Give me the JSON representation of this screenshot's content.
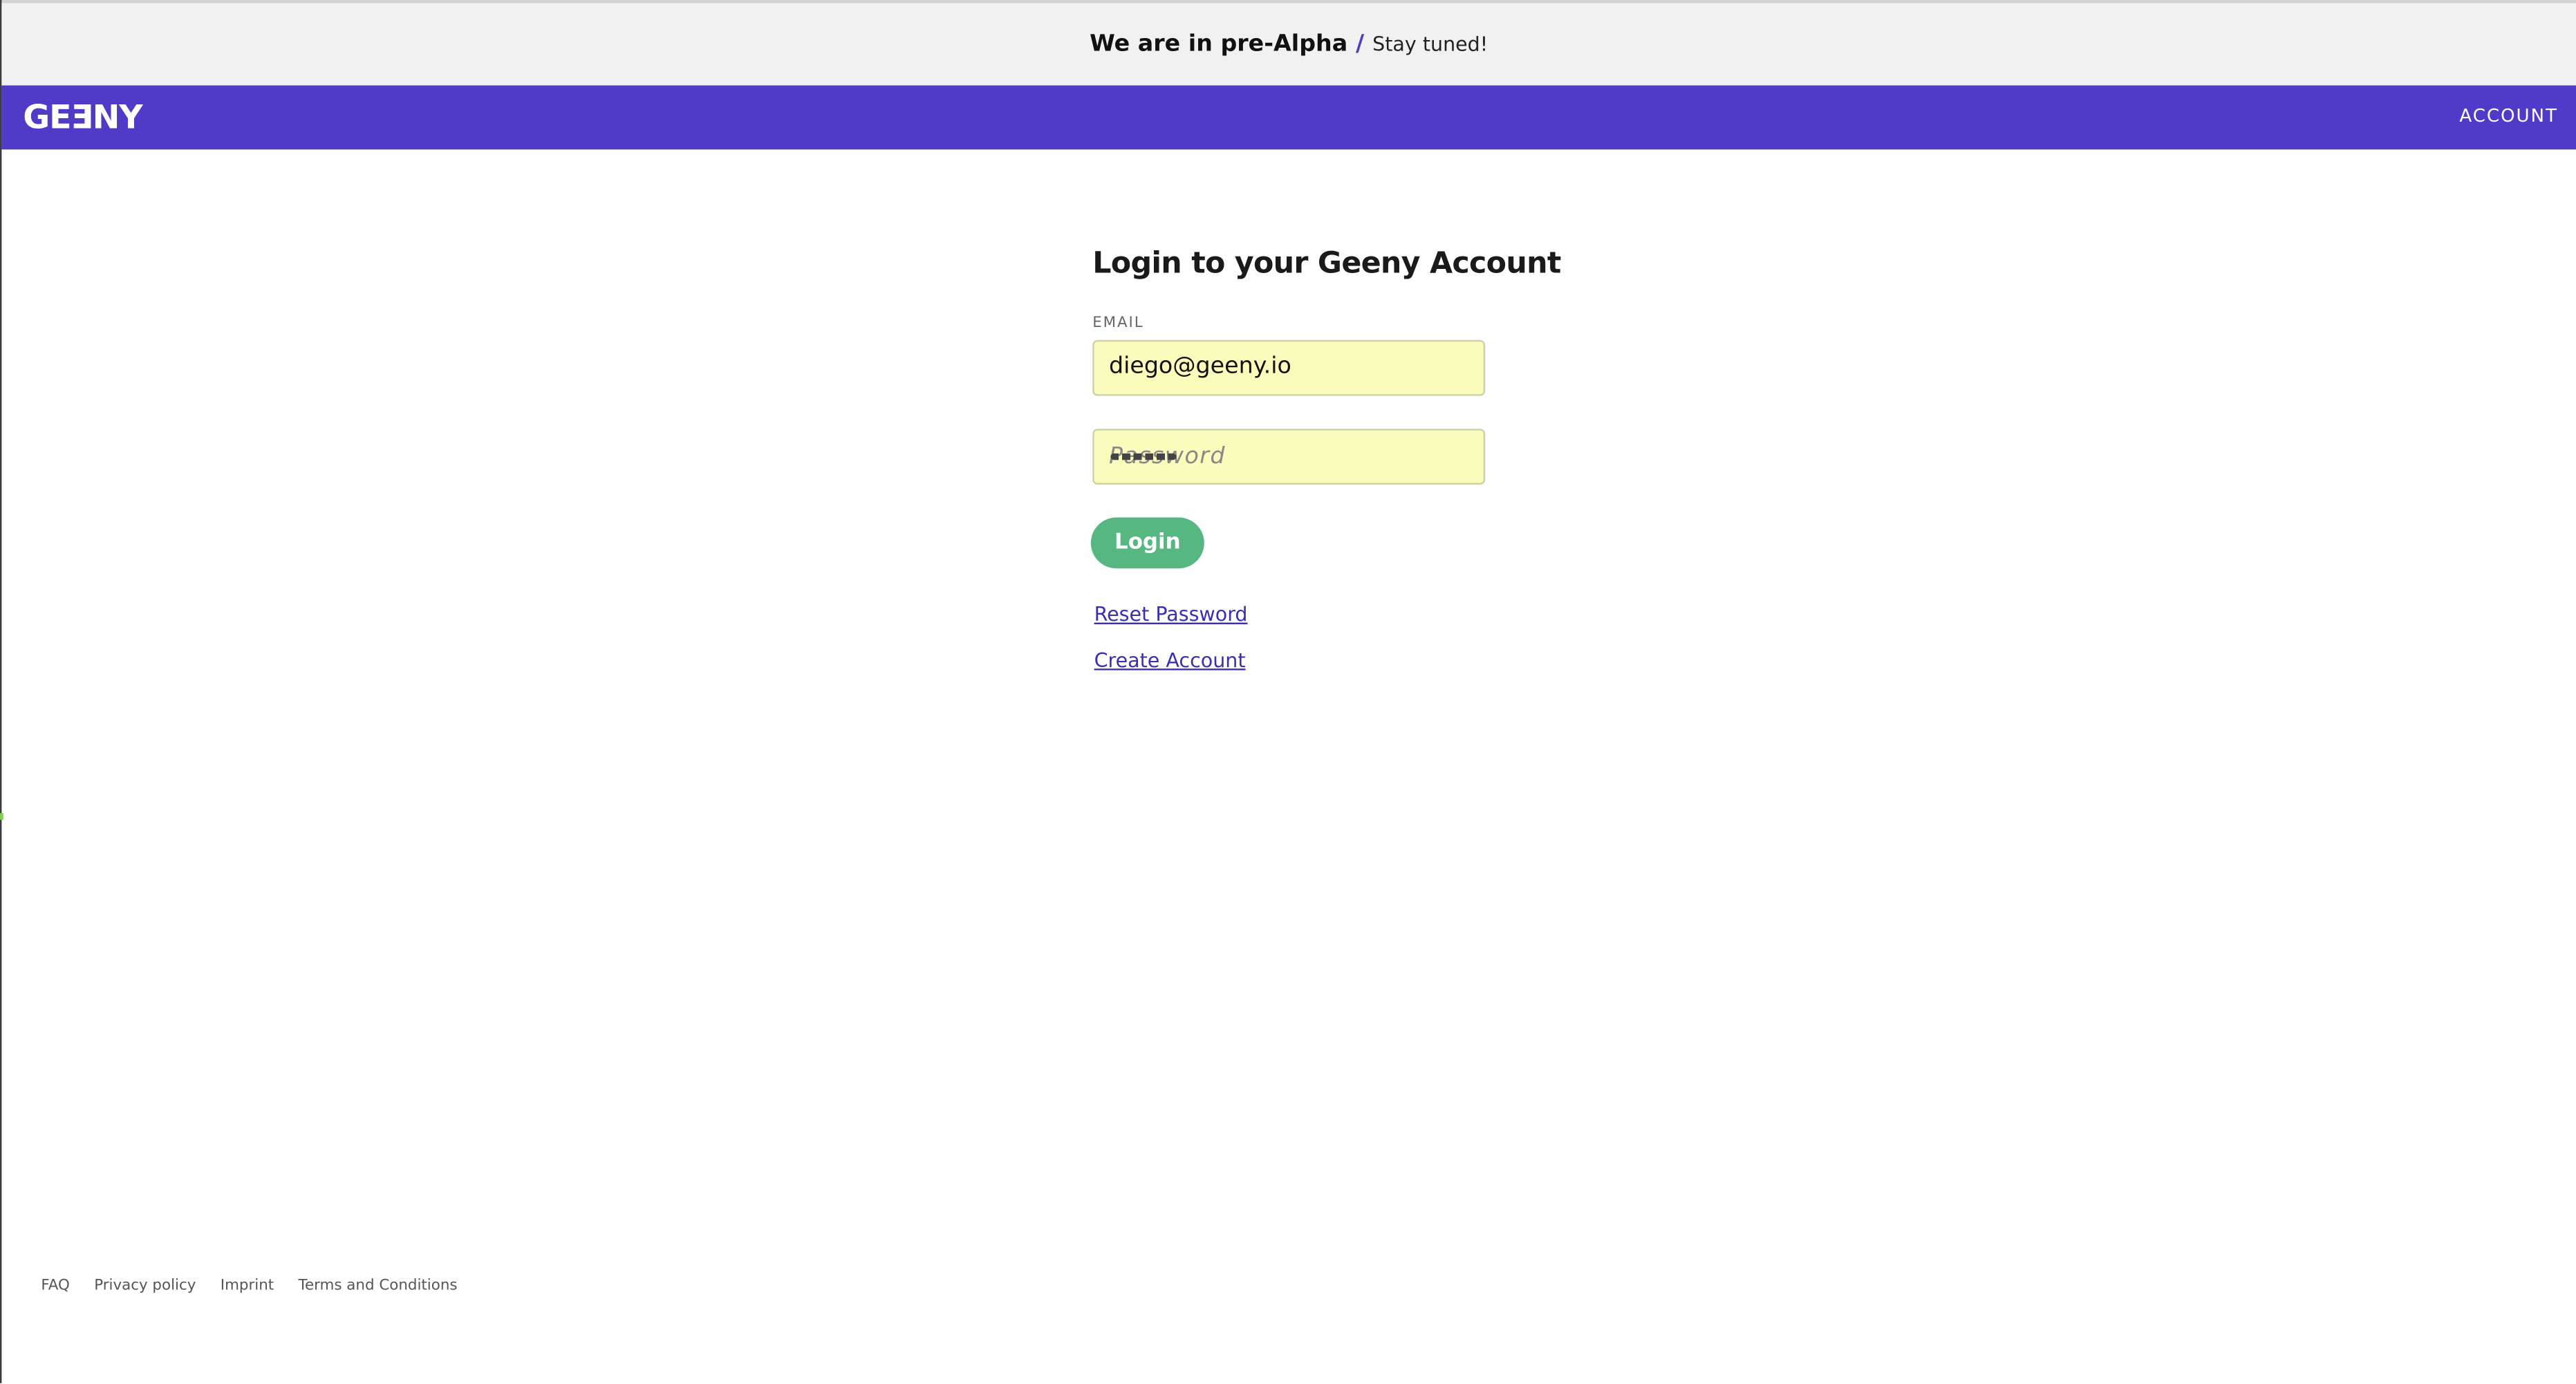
{
  "banner": {
    "headline": "We are in pre-Alpha",
    "separator": "/",
    "subtext": "Stay tuned!"
  },
  "navbar": {
    "logo": "GEƎNY",
    "account_label": "ACCOUNT",
    "background_color": "#4f3bc8"
  },
  "login": {
    "title": "Login to your Geeny Account",
    "email_label": "EMAIL",
    "email_value": "diego@geeny.io",
    "password_placeholder": "Password",
    "login_button": "Login",
    "login_button_color": "#56b880",
    "input_background": "#fafcbc",
    "reset_password_link": "Reset Password",
    "create_account_link": "Create Account"
  },
  "footer": {
    "links": [
      "FAQ",
      "Privacy policy",
      "Imprint",
      "Terms and Conditions"
    ]
  }
}
